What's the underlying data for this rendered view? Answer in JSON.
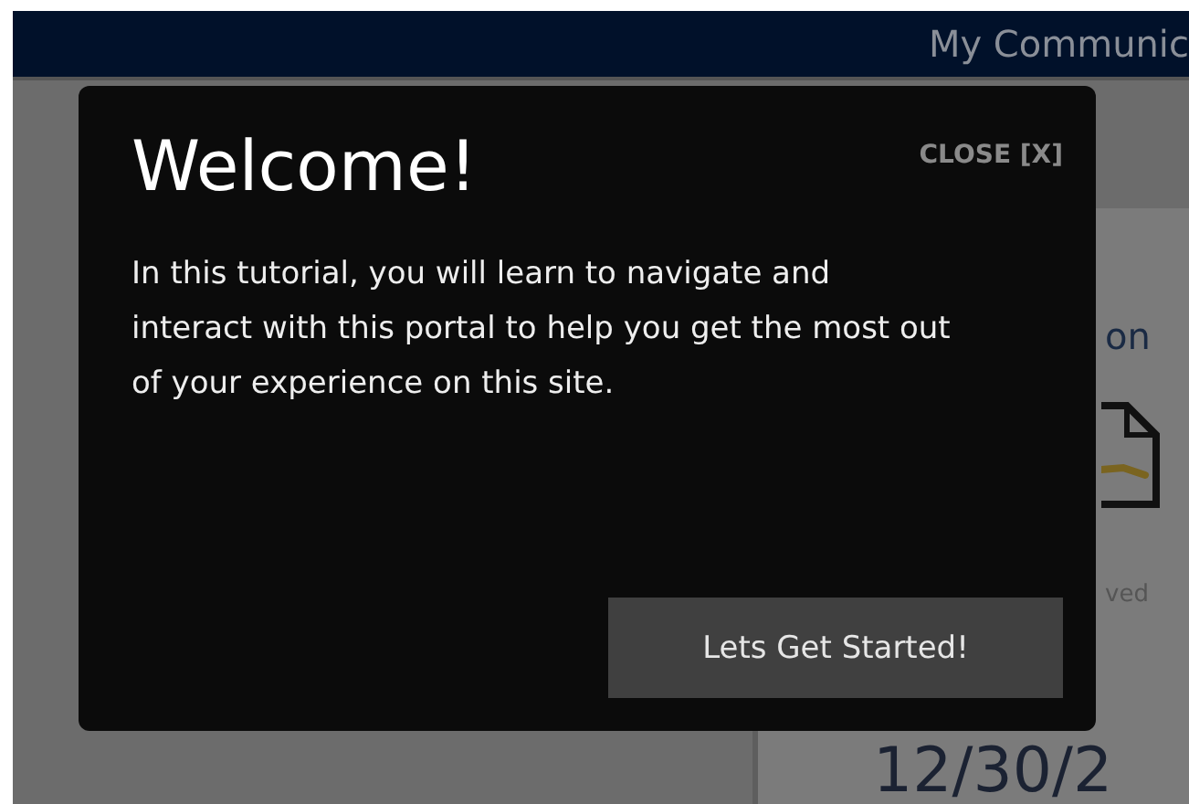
{
  "header": {
    "title": "My Communic"
  },
  "card": {
    "title": "on",
    "date_label": "ved",
    "date": "12/30/2"
  },
  "modal": {
    "title": "Welcome!",
    "close": "CLOSE [X]",
    "body": "In this tutorial, you will learn to navigate and interact with this portal to help you get the most out of your experience on this site.",
    "button": "Lets Get Started!"
  }
}
